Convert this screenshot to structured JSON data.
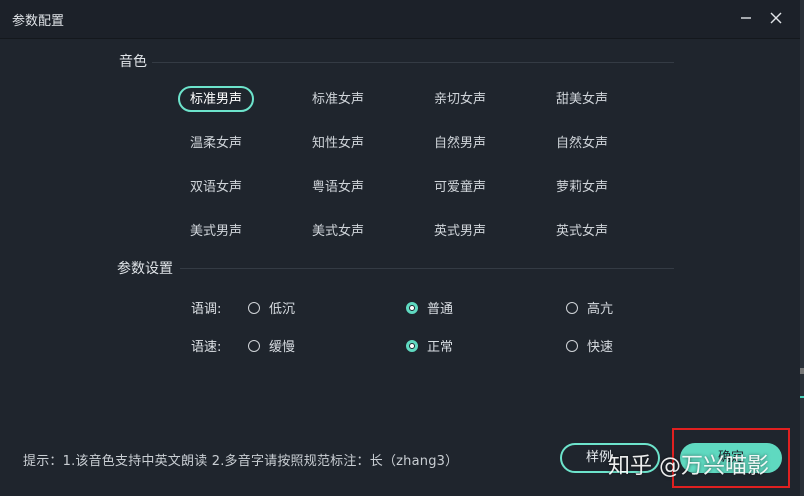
{
  "window": {
    "title": "参数配置"
  },
  "sections": {
    "voice_label": "音色",
    "params_label": "参数设置"
  },
  "voices": [
    {
      "label": "标准男声",
      "selected": true
    },
    {
      "label": "标准女声",
      "selected": false
    },
    {
      "label": "亲切女声",
      "selected": false
    },
    {
      "label": "甜美女声",
      "selected": false
    },
    {
      "label": "温柔女声",
      "selected": false
    },
    {
      "label": "知性女声",
      "selected": false
    },
    {
      "label": "自然男声",
      "selected": false
    },
    {
      "label": "自然女声",
      "selected": false
    },
    {
      "label": "双语女声",
      "selected": false
    },
    {
      "label": "粤语女声",
      "selected": false
    },
    {
      "label": "可爱童声",
      "selected": false
    },
    {
      "label": "萝莉女声",
      "selected": false
    },
    {
      "label": "美式男声",
      "selected": false
    },
    {
      "label": "美式女声",
      "selected": false
    },
    {
      "label": "英式男声",
      "selected": false
    },
    {
      "label": "英式女声",
      "selected": false
    }
  ],
  "params": {
    "tone": {
      "label": "语调:",
      "options": [
        "低沉",
        "普通",
        "高亢"
      ],
      "selected": "普通"
    },
    "speed": {
      "label": "语速:",
      "options": [
        "缓慢",
        "正常",
        "快速"
      ],
      "selected": "正常"
    }
  },
  "footer": {
    "hint": "提示：1.该音色支持中英文朗读  2.多音字请按照规范标注：长（zhang3）",
    "sample_button": "样例",
    "ok_button": "确定"
  },
  "watermark": "知乎 @万兴喵影",
  "colors": {
    "accent": "#5fd9c0",
    "background": "#1f252d",
    "highlight_box": "#e02020"
  }
}
